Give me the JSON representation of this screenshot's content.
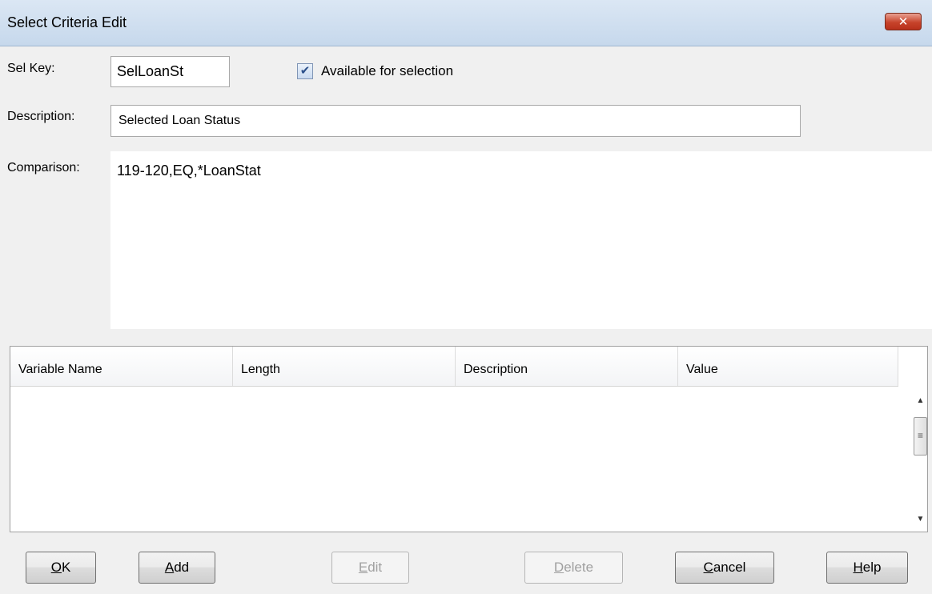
{
  "window": {
    "title": "Select Criteria Edit",
    "close_glyph": "✕"
  },
  "form": {
    "sel_key_label": "Sel Key:",
    "sel_key_value": "SelLoanSt",
    "available_label": "Available for selection",
    "available_checked": true,
    "description_label": "Description:",
    "description_value": "Selected Loan Status",
    "comparison_label": "Comparison:",
    "comparison_value": "119-120,EQ,*LoanStat"
  },
  "grid": {
    "columns": [
      "Variable Name",
      "Length",
      "Description",
      "Value"
    ],
    "rows": []
  },
  "buttons": {
    "ok": {
      "accel": "O",
      "rest": "K",
      "enabled": true
    },
    "add": {
      "accel": "A",
      "rest": "dd",
      "enabled": true
    },
    "edit": {
      "accel": "E",
      "rest": "dit",
      "enabled": false
    },
    "delete": {
      "accel": "D",
      "rest": "elete",
      "enabled": false
    },
    "cancel": {
      "accel": "C",
      "rest": "ancel",
      "enabled": true
    },
    "help": {
      "accel": "H",
      "rest": "elp",
      "enabled": true
    }
  },
  "icons": {
    "checkmark": "check-icon",
    "scroll_up": "chevron-up-icon",
    "scroll_down": "chevron-down-icon"
  }
}
